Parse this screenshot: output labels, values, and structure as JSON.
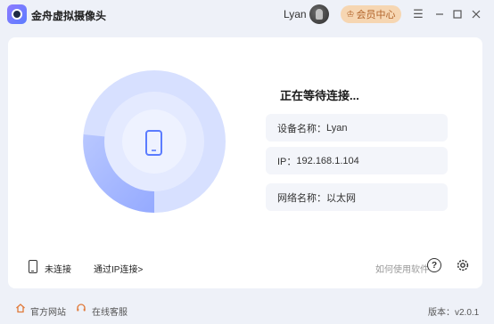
{
  "titlebar": {
    "app_title": "金舟虚拟摄像头",
    "user_name": "Lyan",
    "vip_label": "会员中心",
    "vip_icon": "crown-icon"
  },
  "main": {
    "status_title": "正在等待连接...",
    "device_label": "设备名称：",
    "device_value": "Lyan",
    "ip_label": "IP：",
    "ip_value": "192.168.1.104",
    "network_label": "网络名称：",
    "network_value": "以太网"
  },
  "footer": {
    "connection_status": "未连接",
    "ip_connect_link": "通过IP连接>",
    "howto_link": "如何使用软件",
    "help_symbol": "?"
  },
  "bottom": {
    "site_link": "官方网站",
    "service_link": "在线客服",
    "version": "版本：v2.0.1"
  },
  "colors": {
    "accent": "#5b7cff",
    "radar_outer": "#cdd9ff",
    "radar_inner": "#e8eeff",
    "vip_bg": "#f6d6b2",
    "vip_text": "#b2642a"
  }
}
